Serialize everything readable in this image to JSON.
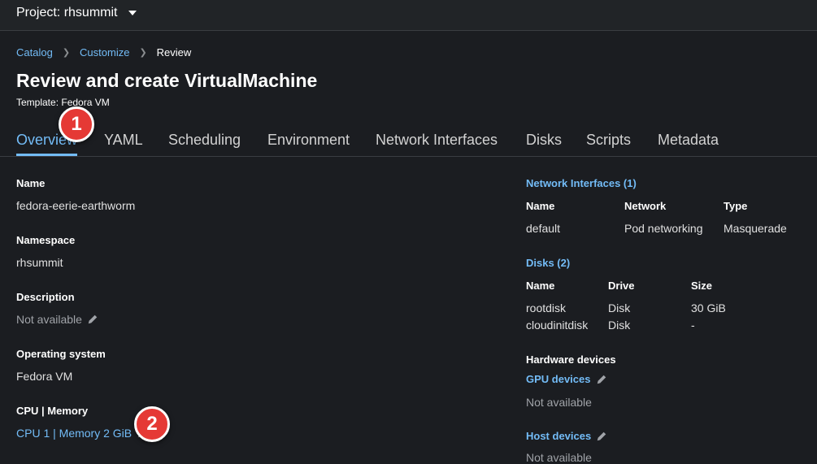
{
  "topbar": {
    "project_label": "Project: rhsummit"
  },
  "breadcrumb": {
    "items": [
      "Catalog",
      "Customize"
    ],
    "current": "Review"
  },
  "page": {
    "title": "Review and create VirtualMachine",
    "template_line": "Template: Fedora VM"
  },
  "tabs": [
    {
      "label": "Overview"
    },
    {
      "label": "YAML"
    },
    {
      "label": "Scheduling"
    },
    {
      "label": "Environment"
    },
    {
      "label": "Network Interfaces"
    },
    {
      "label": "Disks"
    },
    {
      "label": "Scripts"
    },
    {
      "label": "Metadata"
    }
  ],
  "details": {
    "name": {
      "label": "Name",
      "value": "fedora-eerie-earthworm"
    },
    "namespace": {
      "label": "Namespace",
      "value": "rhsummit"
    },
    "description": {
      "label": "Description",
      "value": "Not available"
    },
    "os": {
      "label": "Operating system",
      "value": "Fedora VM"
    },
    "cpu_memory": {
      "label": "CPU | Memory",
      "value": "CPU 1 | Memory 2 GiB"
    }
  },
  "network_interfaces": {
    "title": "Network Interfaces (1)",
    "columns": [
      "Name",
      "Network",
      "Type"
    ],
    "rows": [
      [
        "default",
        "Pod networking",
        "Masquerade"
      ]
    ]
  },
  "disks": {
    "title": "Disks (2)",
    "columns": [
      "Name",
      "Drive",
      "Size"
    ],
    "rows": [
      [
        "rootdisk",
        "Disk",
        "30 GiB"
      ],
      [
        "cloudinitdisk",
        "Disk",
        "-"
      ]
    ]
  },
  "hardware": {
    "label": "Hardware devices",
    "gpu": {
      "title": "GPU devices",
      "value": "Not available"
    },
    "host": {
      "title": "Host devices",
      "value": "Not available"
    }
  },
  "markers": [
    "1",
    "2"
  ],
  "colors": {
    "background": "#1b1d21",
    "link": "#73bcf7",
    "marker": "#e53935"
  }
}
